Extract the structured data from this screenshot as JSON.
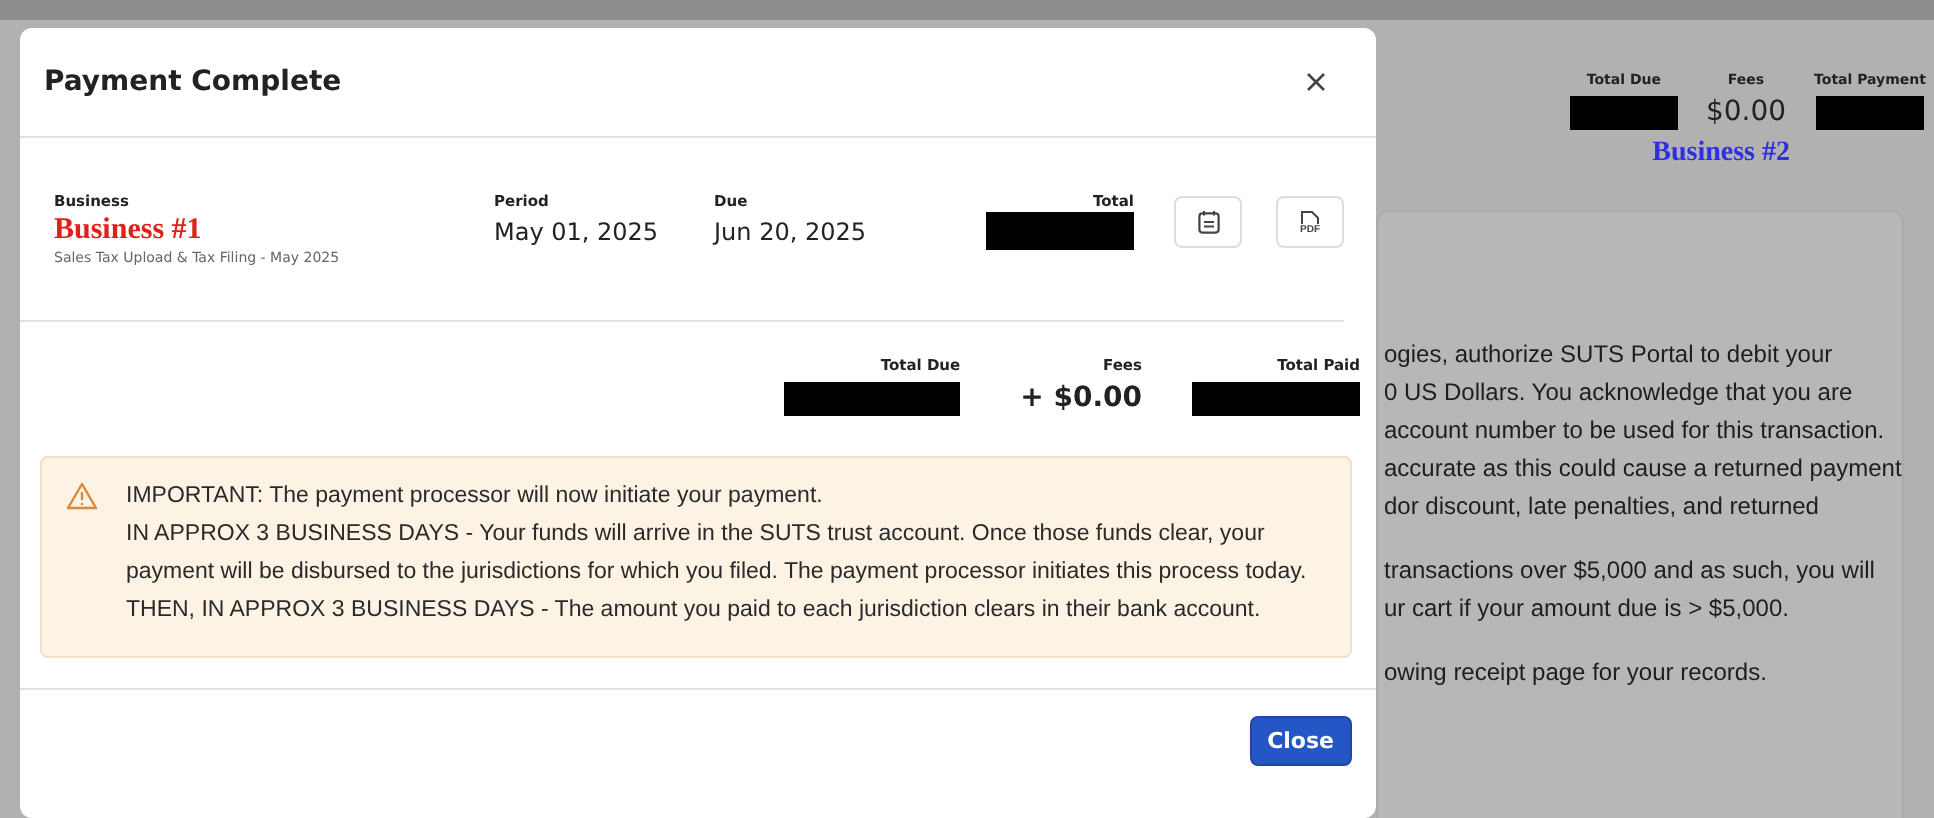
{
  "background": {
    "totals": [
      {
        "label": "Total Due",
        "redacted": true
      },
      {
        "label": "Fees",
        "value": "$0.00",
        "redacted": false
      },
      {
        "label": "Total Payment",
        "redacted": true
      }
    ],
    "business": "Business #2",
    "paragraphs": [
      [
        "ogies, authorize SUTS Portal to debit your",
        "0 US Dollars. You acknowledge that you are",
        "account number to be used for this transaction.",
        "accurate as this could cause a returned payment",
        "dor discount, late penalties, and returned"
      ],
      [
        "transactions over $5,000 and as such, you will",
        "ur cart if your amount due is > $5,000."
      ],
      [
        "owing receipt page for your records."
      ]
    ]
  },
  "modal": {
    "title": "Payment Complete",
    "filing": {
      "business": {
        "label": "Business",
        "name": "Business #1",
        "description": "Sales Tax Upload & Tax Filing - May 2025"
      },
      "period": {
        "label": "Period",
        "value": "May 01, 2025"
      },
      "due": {
        "label": "Due",
        "value": "Jun 20, 2025"
      },
      "total": {
        "label": "Total",
        "redacted": true
      },
      "actions": [
        {
          "kind": "calendar"
        },
        {
          "kind": "pdf",
          "label": "PDF"
        }
      ]
    },
    "totals": [
      {
        "label": "Total Due",
        "redacted": true
      },
      {
        "label": "Fees",
        "value": "+ $0.00",
        "redacted": false
      },
      {
        "label": "Total Paid",
        "redacted": true
      }
    ],
    "notice": {
      "kind": "warning",
      "lines": [
        "IMPORTANT: The payment processor will now initiate your payment.",
        "IN APPROX 3 BUSINESS DAYS - Your funds will arrive in the SUTS trust account. Once those funds clear, your payment will be disbursed to the jurisdictions for which you filed. The payment processor initiates this process today.",
        "THEN, IN APPROX 3 BUSINESS DAYS - The amount you paid to each jurisdiction clears in their bank account."
      ]
    },
    "buttons": [
      "Close"
    ]
  }
}
